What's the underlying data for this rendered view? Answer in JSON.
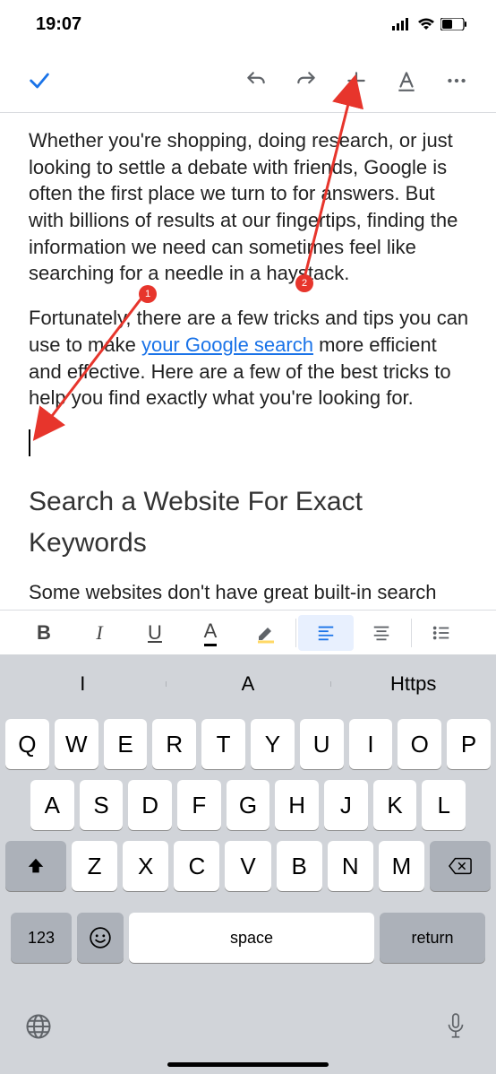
{
  "status": {
    "time": "19:07"
  },
  "toolbar": {
    "accept_icon": "checkmark",
    "undo_icon": "undo",
    "redo_icon": "redo",
    "insert_icon": "plus",
    "textstyle_icon": "A-underline",
    "more_icon": "ellipsis"
  },
  "document": {
    "p1_pre": "Whether you're shopping, doing research, or just looking to settle a debate with friends, Google is often the first place we turn to for answers. But with billions of results at our fingertips, finding the information we need can sometimes feel like searching for a needle in a haystack.",
    "p2_pre": "Fortunately, there are a few tricks and tips you can use to make ",
    "p2_link": "your Google search",
    "p2_post": " more efficient and effective. Here are a few of the best tricks to help you find exactly what you're looking for.",
    "h2": "Search a Website For Exact Keywords",
    "p3": "Some websites don't have great built-in search"
  },
  "format_bar": {
    "bold": "B",
    "italic": "I",
    "underline": "U",
    "textcolor": "A",
    "highlight_icon": "highlighter",
    "align_left_icon": "align-left",
    "align_center_icon": "align-center",
    "list_icon": "bulleted-list"
  },
  "keyboard": {
    "suggestions": [
      "I",
      "A",
      "Https"
    ],
    "row1": [
      "Q",
      "W",
      "E",
      "R",
      "T",
      "Y",
      "U",
      "I",
      "O",
      "P"
    ],
    "row2": [
      "A",
      "S",
      "D",
      "F",
      "G",
      "H",
      "J",
      "K",
      "L"
    ],
    "row3": [
      "Z",
      "X",
      "C",
      "V",
      "B",
      "N",
      "M"
    ],
    "numkey": "123",
    "space": "space",
    "return": "return"
  },
  "annotations": {
    "badge1": "1",
    "badge2": "2"
  }
}
